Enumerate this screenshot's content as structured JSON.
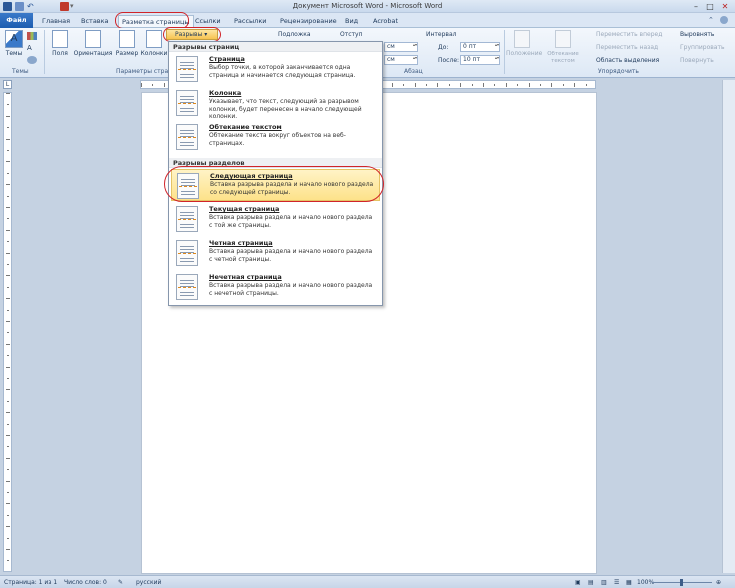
{
  "window": {
    "title": "Документ Microsoft Word - Microsoft Word"
  },
  "tabs": [
    {
      "label": "Файл"
    },
    {
      "label": "Главная"
    },
    {
      "label": "Вставка"
    },
    {
      "label": "Разметка страницы"
    },
    {
      "label": "Ссылки"
    },
    {
      "label": "Рассылки"
    },
    {
      "label": "Рецензирование"
    },
    {
      "label": "Вид"
    },
    {
      "label": "Acrobat"
    }
  ],
  "ribbon": {
    "themes_label": "Темы",
    "themes_group": "Темы",
    "margins": "Поля",
    "orientation": "Ориентация",
    "size": "Размер",
    "columns": "Колонки",
    "page_setup_group": "Параметры страниц",
    "breaks": "Разрывы",
    "watermark": "Подложка",
    "indent": "Отступ",
    "interval": "Интервал",
    "before_label": "До:",
    "before_value": "0 пт",
    "after_label": "После:",
    "after_value": "10 пт",
    "indent_left_value": "см",
    "indent_right_value": "см",
    "paragraph_group": "Абзац",
    "position": "Положение",
    "wrap_text": "Обтекание текстом",
    "bring_forward": "Переместить вперед",
    "send_backward": "Переместить назад",
    "selection_pane": "Область выделения",
    "align": "Выровнять",
    "group": "Группировать",
    "rotate": "Повернуть",
    "arrange_group": "Упорядочить"
  },
  "menu": {
    "page_breaks_header": "Разрывы страниц",
    "section_breaks_header": "Разрывы разделов",
    "items": [
      {
        "title": "Страница",
        "desc": "Выбор точки, в которой заканчивается одна страница и начинается следующая страница."
      },
      {
        "title": "Колонка",
        "desc": "Указывает, что текст, следующий за разрывом колонки, будет перенесен в начало следующей колонки."
      },
      {
        "title": "Обтекание текстом",
        "desc": "Обтекание текста вокруг объектов на веб-страницах."
      },
      {
        "title": "Следующая страница",
        "desc": "Вставка разрыва раздела и начало нового раздела со следующей страницы."
      },
      {
        "title": "Текущая страница",
        "desc": "Вставка разрыва раздела и начало нового раздела с той же страницы."
      },
      {
        "title": "Четная страница",
        "desc": "Вставка разрыва раздела и начало нового раздела с четной страницы."
      },
      {
        "title": "Нечетная страница",
        "desc": "Вставка разрыва раздела и начало нового раздела с нечетной страницы."
      }
    ]
  },
  "ruler": {
    "corner": "L"
  },
  "status": {
    "page": "Страница: 1 из 1",
    "words": "Число слов: 0",
    "language": "русский",
    "zoom": "100%"
  },
  "colors": {
    "accent": "#1c5cb0",
    "highlight": "#fde28a",
    "annotation": "#d0242a"
  }
}
